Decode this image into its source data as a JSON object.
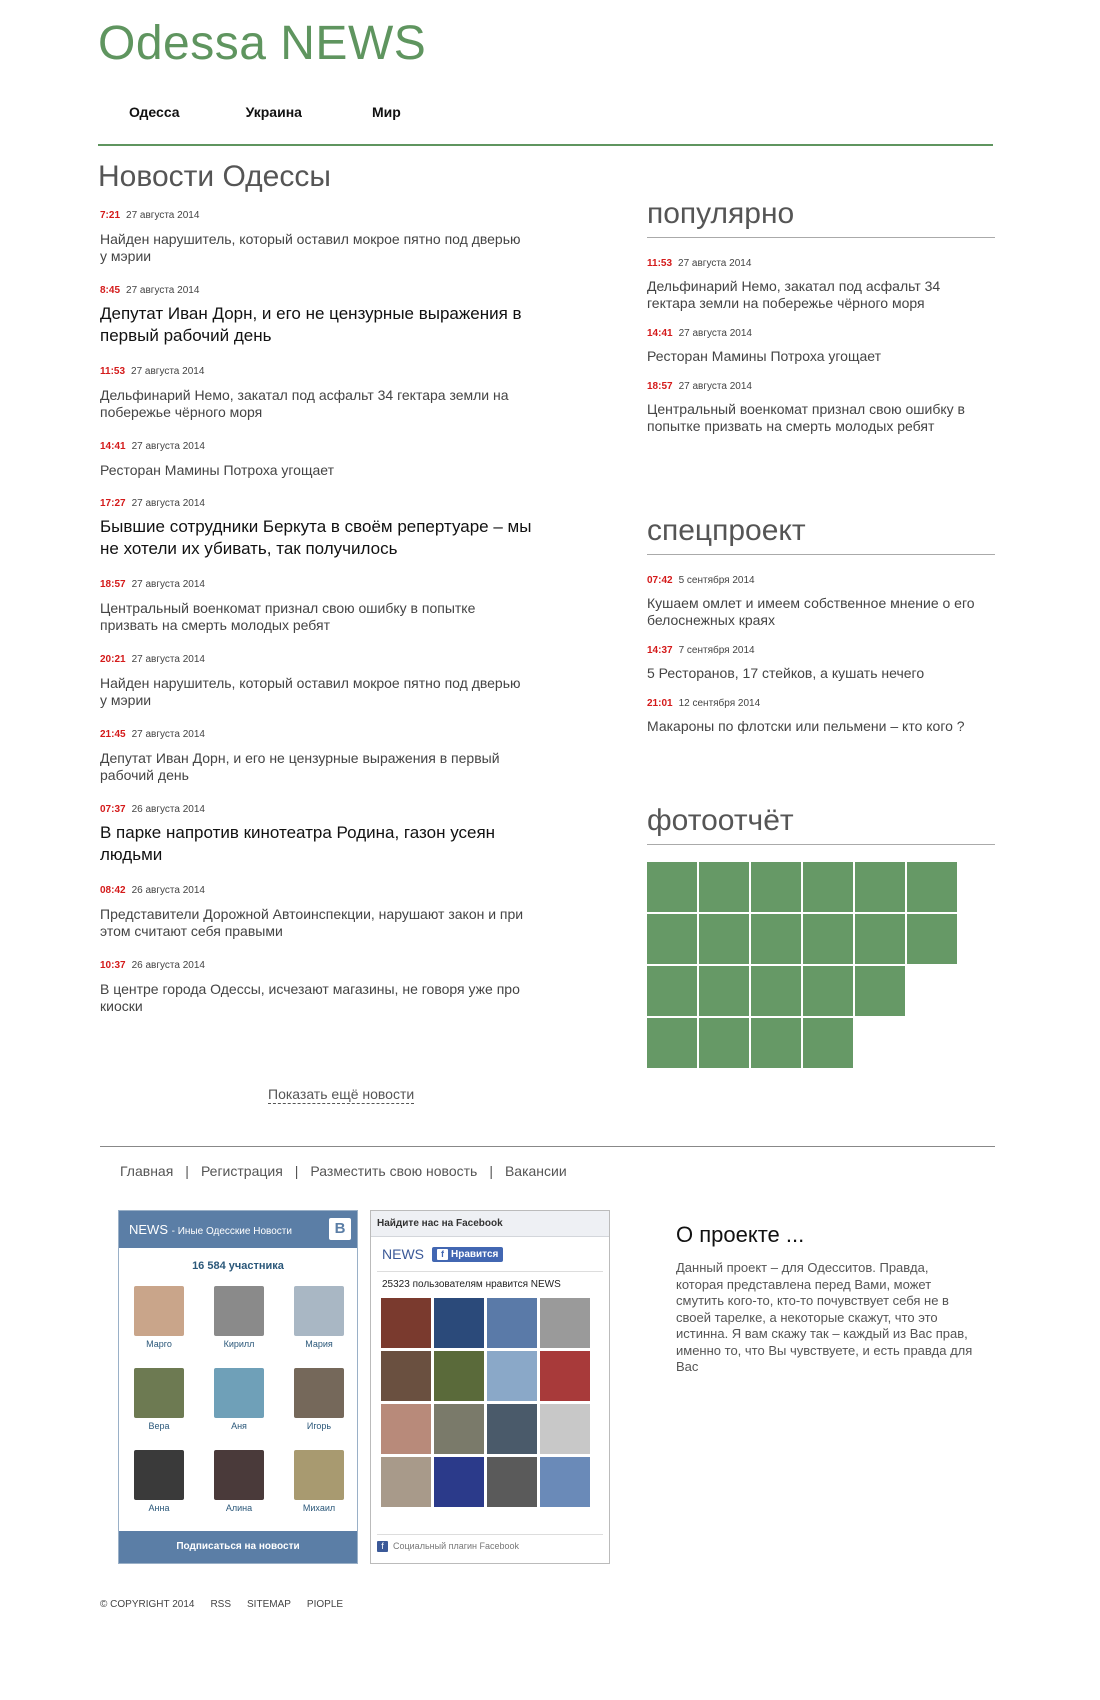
{
  "site": {
    "title": "Odessa NEWS"
  },
  "nav": {
    "items": [
      "Одесса",
      "Украина",
      "Мир"
    ]
  },
  "news": {
    "heading": "Новости Одессы",
    "items": [
      {
        "time": "7:21",
        "date": "27 августа 2014",
        "title": "Найден нарушитель, который оставил мокрое пятно под дверью у мэрии",
        "big": false
      },
      {
        "time": "8:45",
        "date": "27 августа 2014",
        "title": "Депутат Иван Дорн, и его не цензурные выражения в первый рабочий день",
        "big": true
      },
      {
        "time": "11:53",
        "date": "27 августа 2014",
        "title": "Дельфинарий Немо, закатал под асфальт 34 гектара земли на побережье чёрного моря",
        "big": false
      },
      {
        "time": "14:41",
        "date": "27 августа 2014",
        "title": "Ресторан Мамины Потроха угощает",
        "big": false,
        "short": true
      },
      {
        "time": "17:27",
        "date": "27 августа 2014",
        "title": "Бывшие сотрудники Беркута в своём репертуаре – мы не хотели их убивать, так получилось",
        "big": true
      },
      {
        "time": "18:57",
        "date": "27 августа 2014",
        "title": "Центральный военкомат признал свою ошибку в попытке призвать на смерть молодых ребят",
        "big": false
      },
      {
        "time": "20:21",
        "date": "27 августа 2014",
        "title": "Найден нарушитель, который оставил мокрое пятно под дверью у мэрии",
        "big": false
      },
      {
        "time": "21:45",
        "date": "27 августа 2014",
        "title": "Депутат Иван Дорн, и его не цензурные выражения в первый рабочий день",
        "big": false
      },
      {
        "time": "07:37",
        "date": "26 августа 2014",
        "title": "В парке напротив кинотеатра Родина, газон усеян людьми",
        "big": true
      },
      {
        "time": "08:42",
        "date": "26 августа 2014",
        "title": "Представители Дорожной Автоинспекции, нарушают закон и при этом считают себя правыми",
        "big": false
      },
      {
        "time": "10:37",
        "date": "26 августа 2014",
        "title": "В центре города Одессы, исчезают магазины, не говоря уже про киоски",
        "big": false
      }
    ],
    "more_label": "Показать ещё новости"
  },
  "popular": {
    "heading": "популярно",
    "items": [
      {
        "time": "11:53",
        "date": "27 августа 2014",
        "title": "Дельфинарий Немо, закатал под асфальт 34 гектара земли на побережье чёрного моря"
      },
      {
        "time": "14:41",
        "date": "27 августа 2014",
        "title": "Ресторан Мамины Потроха угощает"
      },
      {
        "time": "18:57",
        "date": "27 августа 2014",
        "title": "Центральный военкомат признал свою ошибку в попытке призвать на смерть молодых ребят"
      }
    ]
  },
  "special": {
    "heading": "спецпроект",
    "items": [
      {
        "time": "07:42",
        "date": "5 сентября 2014",
        "title": "Кушаем омлет и имеем собственное мнение о его белоснежных краях"
      },
      {
        "time": "14:37",
        "date": "7 сентября 2014",
        "title": "5 Ресторанов, 17 стейков, а кушать нечего"
      },
      {
        "time": "21:01",
        "date": "12 сентября 2014",
        "title": "Макароны по флотски или пельмени – кто кого ?"
      }
    ]
  },
  "photo": {
    "heading": "фотоотчёт",
    "tile_color": "#669966",
    "rows": [
      6,
      6,
      5,
      4
    ]
  },
  "footer_nav": {
    "items": [
      "Главная",
      "Регистрация",
      "Разместить свою новость",
      "Вакансии"
    ],
    "separator": "|"
  },
  "vk": {
    "title": "NEWS",
    "subtitle": "Иные Одесские Новости",
    "logo": "В",
    "count": "16 584 участника",
    "members": [
      "Марго",
      "Кирилл",
      "Мария",
      "Вера",
      "Аня",
      "Игорь",
      "Анна",
      "Алина",
      "Михаил"
    ],
    "member_colors": [
      "#c9a58a",
      "#8a8a8a",
      "#a9b7c4",
      "#6d7a52",
      "#6fa0b8",
      "#75685a",
      "#3a3a3a",
      "#4a3a3a",
      "#a89a70"
    ],
    "button": "Подписаться на новости"
  },
  "fb": {
    "header": "Найдите нас на Facebook",
    "page_name": "NEWS",
    "like_label": "Нравится",
    "count_prefix": "25323 пользователям нравится ",
    "count_page": "NEWS",
    "face_colors": [
      "#7a3a2e",
      "#2b4a7a",
      "#5a7aa8",
      "#9a9a9a",
      "#6a5040",
      "#5a6a3a",
      "#8aa8c8",
      "#a83a3a",
      "#b88a7a",
      "#7a7a6a",
      "#4a5a6a",
      "#c8c8c8",
      "#a89a8a",
      "#2b3a8a",
      "#5a5a5a",
      "#6a8ab8"
    ],
    "footer": "Социальный плагин Facebook"
  },
  "about": {
    "title": "О проекте ...",
    "text": "Данный проект – для Одесситов. Правда, которая представлена перед Вами, может смутить кого-то, кто-то почувствует себя не в своей тарелке, а некоторые скажут, что это истинна. Я вам скажу так – каждый из Вас прав, именно то, что Вы чувствуете, и есть правда для Вас"
  },
  "copyright": {
    "items": [
      "© COPYRIGHT 2014",
      "RSS",
      "SITEMAP",
      "PIOPLE"
    ]
  }
}
